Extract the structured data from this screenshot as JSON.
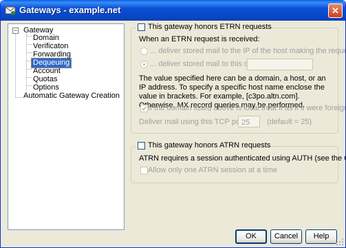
{
  "window": {
    "title": "Gateways - example.net",
    "close_label": "✕"
  },
  "tree": {
    "root": "Gateway",
    "children": [
      "Domain",
      "Verificaton",
      "Forwarding",
      "Dequeuing",
      "Account",
      "Quotas",
      "Options"
    ],
    "selected": "Dequeuing",
    "expander": "−",
    "last": "Automatic Gateway Creation"
  },
  "etrn": {
    "honors_label": "This gateway honors ETRN requests",
    "honors_checked": false,
    "when_label": "When an ETRN request is received:",
    "radio_ip_label": "... deliver stored mail to the IP of the host making the request",
    "radio_domain_label": "... deliver stored mail to this domain",
    "domain_value": "",
    "info_text": "The value specified here can be a domain, a host, or an IP address.  To specify a specific host name enclose the value in brackets.  For example, [c3po.altn.com].  Otherwise, MX record queries may be performed.",
    "local_label": "If the domain listed above is local treat it as if it were foreign",
    "local_checked": true,
    "port_label": "Deliver mail using this TCP port",
    "port_value": "25",
    "port_default": "(default = 25)"
  },
  "atrn": {
    "honors_label": "This gateway honors ATRN requests",
    "honors_checked": false,
    "info_text": "ATRN requires a session authenticated using AUTH (see the Options tab).",
    "one_session_label": "Allow only one ATRN session at a time",
    "one_session_checked": false
  },
  "buttons": {
    "ok": "OK",
    "cancel": "Cancel",
    "help": "Help"
  }
}
